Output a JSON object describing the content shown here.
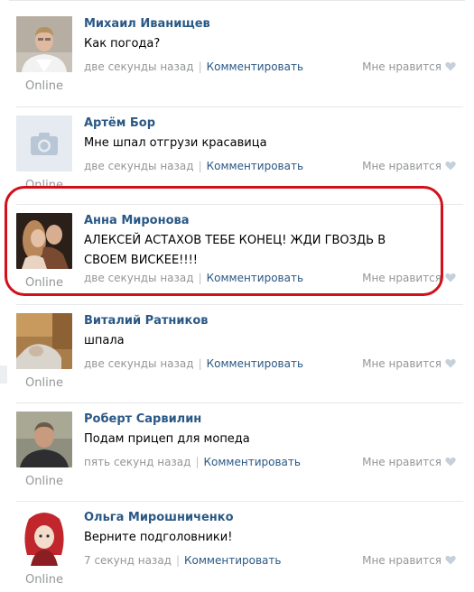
{
  "comments": [
    {
      "author": "Михаил Иванищев",
      "text": "Как погода?",
      "time": "две секунды назад",
      "reply_label": "Комментировать",
      "like_label": "Мне нравится",
      "status": "Online",
      "avatar_icon": "photo-man-suit"
    },
    {
      "author": "Артём Бор",
      "text": "Мне шпал отгрузи красавица",
      "time": "две секунды назад",
      "reply_label": "Комментировать",
      "like_label": "Мне нравится",
      "status": "Online",
      "avatar_icon": "camera-icon"
    },
    {
      "author": "Анна Миронова",
      "text": "АЛЕКСЕЙ АСТАХОВ ТЕБЕ КОНЕЦ! ЖДИ ГВОЗДЬ В СВОЕМ ВИСКЕЕ!!!!",
      "time": "две секунды назад",
      "reply_label": "Комментировать",
      "like_label": "Мне нравится",
      "status": "Online",
      "avatar_icon": "photo-couple"
    },
    {
      "author": "Виталий Ратников",
      "text": "шпала",
      "time": "две секунды назад",
      "reply_label": "Комментировать",
      "like_label": "Мне нравится",
      "status": "Online",
      "avatar_icon": "photo-room"
    },
    {
      "author": "Роберт Сарвилин",
      "text": "Подам прицеп для мопеда",
      "time": "пять секунд назад",
      "reply_label": "Комментировать",
      "like_label": "Мне нравится",
      "status": "Online",
      "avatar_icon": "photo-man"
    },
    {
      "author": "Ольга Мирошниченко",
      "text": "Верните подголовники!",
      "time": "7 секунд назад",
      "reply_label": "Комментировать",
      "like_label": "Мне нравится",
      "status": "Online",
      "avatar_icon": "photo-cartoon-girl"
    }
  ],
  "colors": {
    "author": "#2a5885",
    "meta": "#939699",
    "highlight": "#d2101a",
    "heart": "#c5d0db"
  }
}
